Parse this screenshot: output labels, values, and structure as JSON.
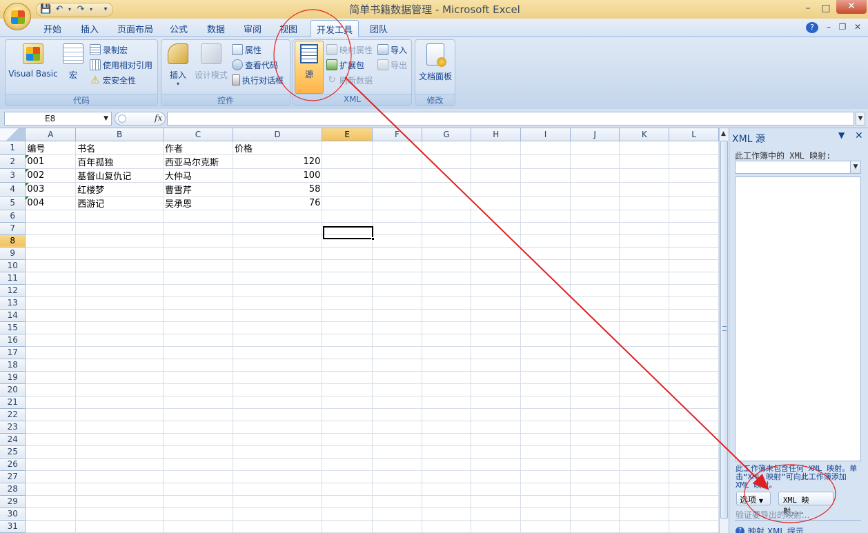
{
  "window": {
    "title": "简单书籍数据管理 - Microsoft Excel",
    "controls": {
      "minimize": "–",
      "maximize": "□",
      "close": "✕"
    },
    "app_controls": {
      "help": "?",
      "minimize": "–",
      "restore": "❐",
      "close": "✕"
    }
  },
  "tabs": [
    "开始",
    "插入",
    "页面布局",
    "公式",
    "数据",
    "审阅",
    "视图",
    "开发工具",
    "团队"
  ],
  "active_tab": "开发工具",
  "ribbon": {
    "code": {
      "label": "代码",
      "visual_basic": "Visual Basic",
      "macros": "宏",
      "record_macro": "录制宏",
      "relative_ref": "使用相对引用",
      "macro_security": "宏安全性"
    },
    "controls": {
      "label": "控件",
      "insert": "插入",
      "design_mode": "设计模式",
      "properties": "属性",
      "view_code": "查看代码",
      "run_dialog": "执行对话框"
    },
    "xml": {
      "label": "XML",
      "source": "源",
      "map_properties": "映射属性",
      "expansion_packs": "扩展包",
      "refresh_data": "刷新数据",
      "import": "导入",
      "export": "导出"
    },
    "modify": {
      "label": "修改",
      "document_panel": "文档面板"
    }
  },
  "formula_bar": {
    "name_box": "E8",
    "fx": "fx",
    "formula": ""
  },
  "sheet": {
    "columns": [
      "A",
      "B",
      "C",
      "D",
      "E",
      "F",
      "G",
      "H",
      "I",
      "J",
      "K",
      "L"
    ],
    "selected_column": "E",
    "selected_row": 8,
    "rows": [
      {
        "n": "1",
        "a": "编号",
        "b": "书名",
        "c": "作者",
        "d": "价格"
      },
      {
        "n": "2",
        "a": "001",
        "b": "百年孤独",
        "c": "西亚马尔克斯",
        "d": "120"
      },
      {
        "n": "3",
        "a": "002",
        "b": "基督山复仇记",
        "c": "大仲马",
        "d": "100"
      },
      {
        "n": "4",
        "a": "003",
        "b": "红楼梦",
        "c": "曹雪芹",
        "d": "58"
      },
      {
        "n": "5",
        "a": "004",
        "b": "西游记",
        "c": "吴承恩",
        "d": "76"
      }
    ],
    "total_rows": 32
  },
  "xml_pane": {
    "title": "XML 源",
    "maps_label": "此工作簿中的 XML 映射:",
    "message": "此工作簿未包含任何 XML 映射。单击“XML 映射”可向此工作簿添加 XML 映射。",
    "options_button": "选项",
    "xml_maps_button": "XML 映射...",
    "verify_link": "验证要导出的映射...",
    "help_link": "映射 XML 提示"
  },
  "colors": {
    "annotation": "#e02020",
    "ribbon_bg": "#d5e2f3",
    "active_button": "#ffd47a",
    "header_selected": "#f1c15f"
  }
}
